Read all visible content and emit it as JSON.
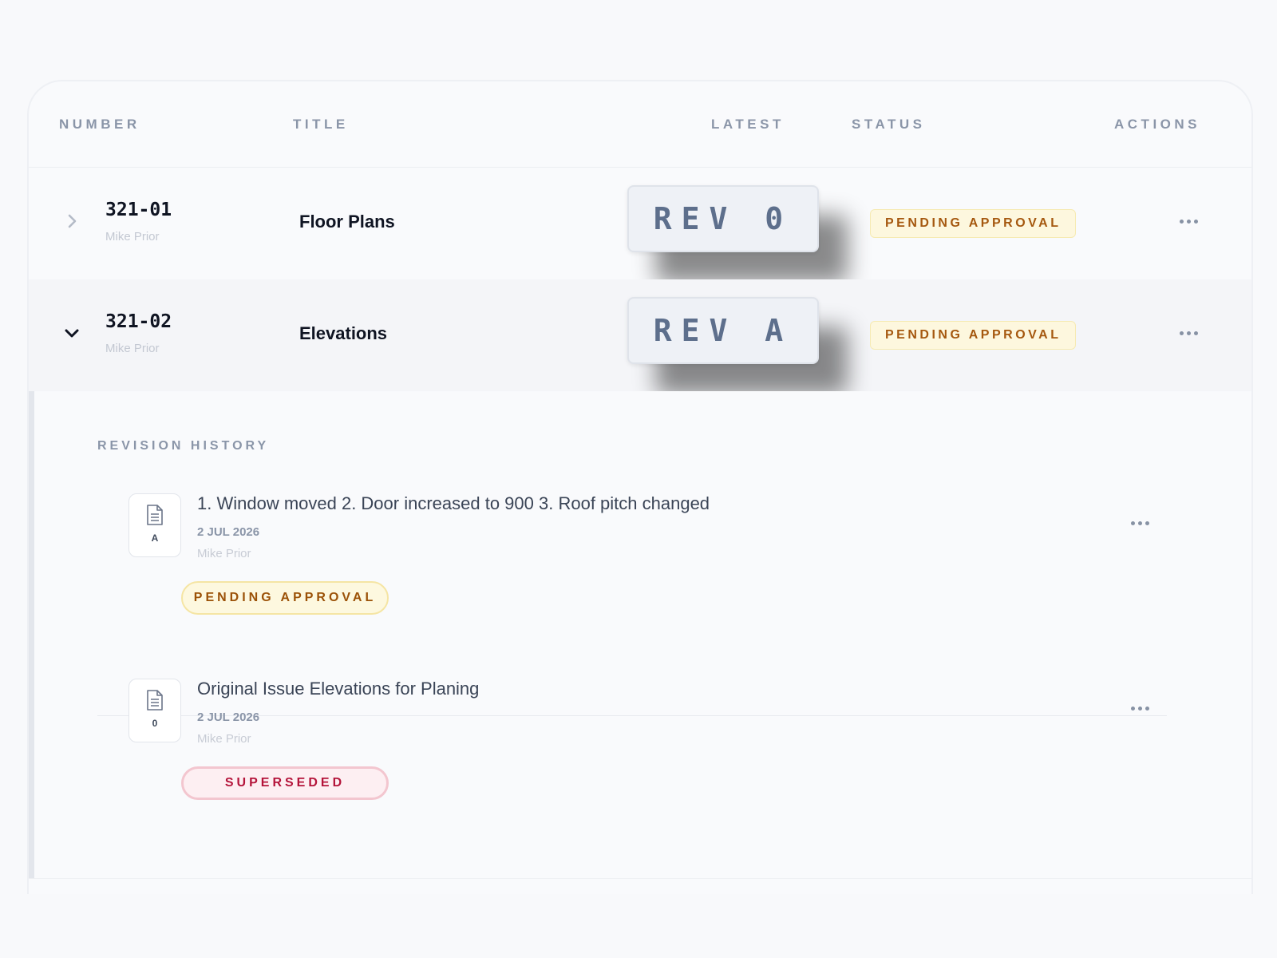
{
  "table": {
    "headers": {
      "number": "NUMBER",
      "title": "TITLE",
      "latest": "LATEST",
      "status": "STATUS",
      "actions": "ACTIONS"
    },
    "rows": [
      {
        "number": "321-01",
        "author": "Mike Prior",
        "title": "Floor Plans",
        "latest": "REV 0",
        "status": "PENDING APPROVAL",
        "expanded": false,
        "chevron_icon": "chevron-right-icon",
        "actions_icon": "more-horizontal-icon"
      },
      {
        "number": "321-02",
        "author": "Mike Prior",
        "title": "Elevations",
        "latest": "REV A",
        "status": "PENDING APPROVAL",
        "expanded": true,
        "chevron_icon": "chevron-down-icon",
        "actions_icon": "more-horizontal-icon"
      }
    ]
  },
  "revision_history": {
    "label": "REVISION HISTORY",
    "items": [
      {
        "rev": "A",
        "description": "1. Window moved 2. Door increased to 900 3. Roof pitch changed",
        "date": "2 JUL 2026",
        "author": "Mike Prior",
        "status": "PENDING APPROVAL",
        "icon": "document-icon"
      },
      {
        "rev": "0",
        "description": "Original Issue Elevations for Planing",
        "date": "2 JUL 2026",
        "author": "Mike Prior",
        "status": "SUPERSEDED",
        "icon": "document-icon"
      }
    ]
  },
  "colors": {
    "pending_text": "#a5580f",
    "pending_bg": "#fdf7de",
    "superseded_text": "#b4143a",
    "superseded_bg": "#fdeff2",
    "header_text": "#8a95a8",
    "primary_text": "#0f1422"
  }
}
